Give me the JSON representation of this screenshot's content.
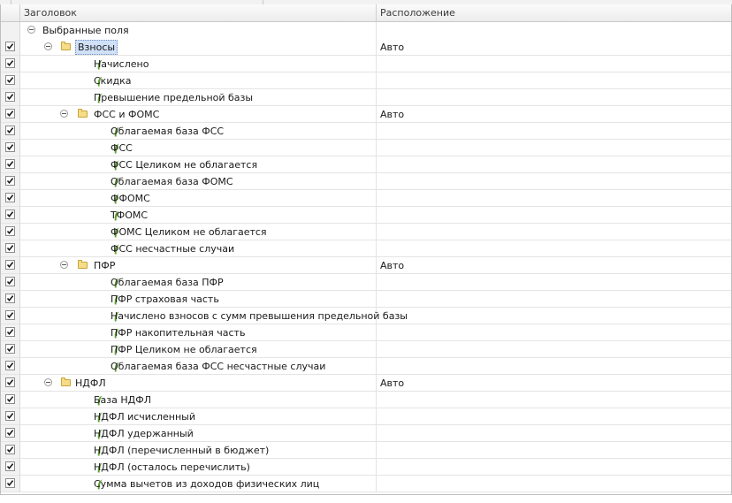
{
  "columns": {
    "title": "Заголовок",
    "placement": "Расположение"
  },
  "rows": [
    {
      "label": "Выбранные поля",
      "kind": "root",
      "level": 0,
      "checked": false,
      "placement": ""
    },
    {
      "label": "Взносы",
      "kind": "group",
      "level": 1,
      "checked": true,
      "placement": "Авто",
      "selected": true
    },
    {
      "label": "Начислено",
      "kind": "field",
      "level": 2,
      "checked": true,
      "placement": ""
    },
    {
      "label": "Скидка",
      "kind": "field",
      "level": 2,
      "checked": true,
      "placement": ""
    },
    {
      "label": "Превышение предельной базы",
      "kind": "field",
      "level": 2,
      "checked": true,
      "placement": ""
    },
    {
      "label": "ФСС и ФОМС",
      "kind": "group",
      "level": 2,
      "checked": true,
      "placement": "Авто"
    },
    {
      "label": "Облагаемая база ФСС",
      "kind": "field",
      "level": 3,
      "checked": true,
      "placement": ""
    },
    {
      "label": "ФСС",
      "kind": "field",
      "level": 3,
      "checked": true,
      "placement": ""
    },
    {
      "label": "ФСС Целиком не облагается",
      "kind": "field",
      "level": 3,
      "checked": true,
      "placement": ""
    },
    {
      "label": "Облагаемая база ФОМС",
      "kind": "field",
      "level": 3,
      "checked": true,
      "placement": ""
    },
    {
      "label": "ФФОМС",
      "kind": "field",
      "level": 3,
      "checked": true,
      "placement": ""
    },
    {
      "label": "ТФОМС",
      "kind": "field",
      "level": 3,
      "checked": true,
      "placement": ""
    },
    {
      "label": "ФОМС Целиком не облагается",
      "kind": "field",
      "level": 3,
      "checked": true,
      "placement": ""
    },
    {
      "label": "ФСС несчастные случаи",
      "kind": "field",
      "level": 3,
      "checked": true,
      "placement": ""
    },
    {
      "label": "ПФР",
      "kind": "group",
      "level": 2,
      "checked": true,
      "placement": "Авто"
    },
    {
      "label": "Облагаемая база ПФР",
      "kind": "field",
      "level": 3,
      "checked": true,
      "placement": ""
    },
    {
      "label": "ПФР страховая часть",
      "kind": "field",
      "level": 3,
      "checked": true,
      "placement": ""
    },
    {
      "label": "Начислено взносов с сумм превышения предельной базы",
      "kind": "field",
      "level": 3,
      "checked": true,
      "placement": ""
    },
    {
      "label": "ПФР накопительная часть",
      "kind": "field",
      "level": 3,
      "checked": true,
      "placement": ""
    },
    {
      "label": "ПФР Целиком не облагается",
      "kind": "field",
      "level": 3,
      "checked": true,
      "placement": ""
    },
    {
      "label": "Облагаемая база ФСС несчастные случаи",
      "kind": "field",
      "level": 3,
      "checked": true,
      "placement": ""
    },
    {
      "label": "НДФЛ",
      "kind": "group",
      "level": 1,
      "checked": true,
      "placement": "Авто"
    },
    {
      "label": "База НДФЛ",
      "kind": "field",
      "level": 2,
      "checked": true,
      "placement": ""
    },
    {
      "label": "НДФЛ исчисленный",
      "kind": "field",
      "level": 2,
      "checked": true,
      "placement": ""
    },
    {
      "label": "НДФЛ удержанный",
      "kind": "field",
      "level": 2,
      "checked": true,
      "placement": ""
    },
    {
      "label": "НДФЛ (перечисленный в бюджет)",
      "kind": "field",
      "level": 2,
      "checked": true,
      "placement": ""
    },
    {
      "label": "НДФЛ (осталось перечислить)",
      "kind": "field",
      "level": 2,
      "checked": true,
      "placement": ""
    },
    {
      "label": "Сумма вычетов из доходов физических лиц",
      "kind": "field",
      "level": 2,
      "checked": true,
      "placement": ""
    }
  ],
  "colors": {
    "selection_bg": "#cfe0f7",
    "folder": "#f6dc86",
    "field_icon": "#5aa02c",
    "checkmark": "#1a1a1a"
  }
}
